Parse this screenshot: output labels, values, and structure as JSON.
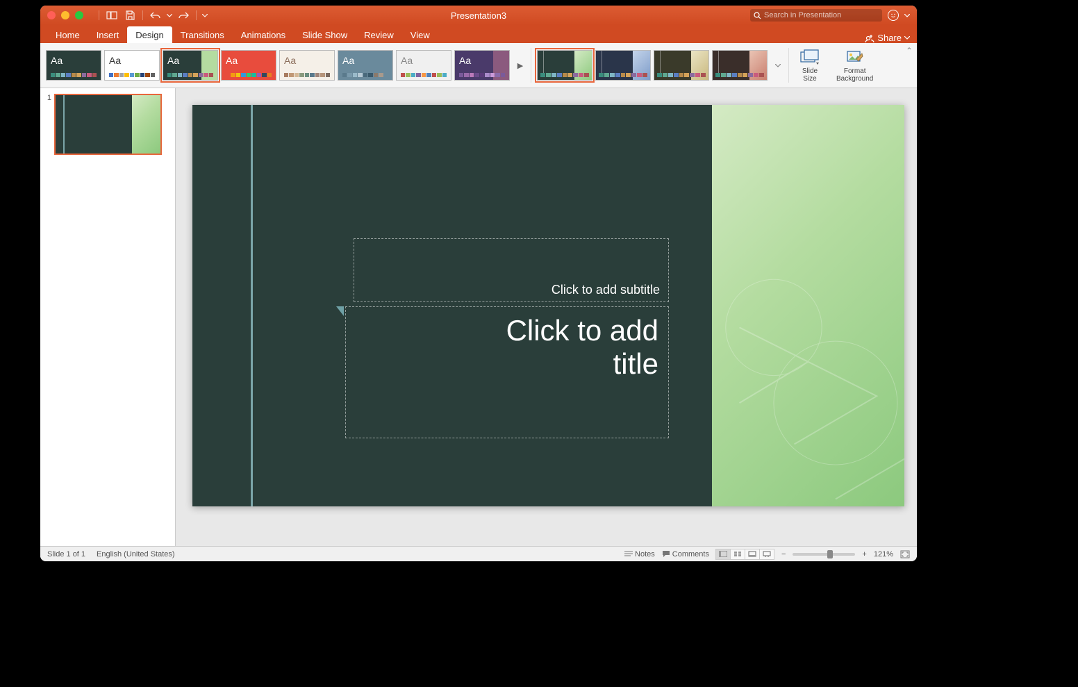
{
  "title": "Presentation3",
  "search_placeholder": "Search in Presentation",
  "share_label": "Share",
  "tabs": [
    "Home",
    "Insert",
    "Design",
    "Transitions",
    "Animations",
    "Slide Show",
    "Review",
    "View"
  ],
  "active_tab": "Design",
  "tools": {
    "slide_size": "Slide\nSize",
    "format_bg": "Format\nBackground"
  },
  "slide": {
    "subtitle_placeholder": "Click to add subtitle",
    "title_placeholder": "Click to add\ntitle"
  },
  "thumb_num": "1",
  "status": {
    "slide_info": "Slide 1 of 1",
    "language": "English (United States)",
    "notes": "Notes",
    "comments": "Comments",
    "zoom": "121%"
  },
  "theme_thumbs": [
    {
      "bg": "#2a3e3a",
      "aa": "#fff",
      "strip": [
        "#3a8d7d",
        "#5fa890",
        "#7eb5c4",
        "#5a7ec2",
        "#b88a4a",
        "#d4a259",
        "#8b6b9e",
        "#c95b7e",
        "#aa5252"
      ]
    },
    {
      "bg": "#ffffff",
      "aa": "#333",
      "strip": [
        "#4472c4",
        "#ed7d31",
        "#a5a5a5",
        "#ffc000",
        "#5b9bd5",
        "#70ad47",
        "#264478",
        "#9e480e",
        "#636363"
      ]
    },
    {
      "bg": "#2a3e3a",
      "aa": "#fff",
      "side": "#b4dca0",
      "sel": true,
      "strip": [
        "#3a8d7d",
        "#5fa890",
        "#7eb5c4",
        "#5a7ec2",
        "#b88a4a",
        "#d4a259",
        "#8b6b9e",
        "#c95b7e",
        "#aa5252"
      ]
    },
    {
      "bg": "#e84c3d",
      "aa": "#fff",
      "strip": [
        "#e84c3d",
        "#f39c12",
        "#f1c40f",
        "#3498db",
        "#2ecc71",
        "#1abc9c",
        "#9b59b6",
        "#34495e",
        "#e67e22"
      ]
    },
    {
      "bg": "#f5f0e8",
      "aa": "#8a6d5a",
      "strip": [
        "#a87c5f",
        "#c19875",
        "#d4b896",
        "#8a9a7e",
        "#6b8e7f",
        "#5a7a8c",
        "#9e8579",
        "#b6957a",
        "#7a6a5f"
      ]
    },
    {
      "bg": "#6a8a9c",
      "aa": "#fff",
      "strip": [
        "#5a7a8c",
        "#7a9aac",
        "#9abaca",
        "#b5c8d4",
        "#4a6a7c",
        "#3a5a6c",
        "#8a7a6c",
        "#a89a8c",
        "#6a8a9c"
      ]
    },
    {
      "bg": "#f0f0f0",
      "aa": "#888",
      "strip": [
        "#c0504d",
        "#9bbb59",
        "#4bacc6",
        "#8064a2",
        "#f79646",
        "#4f81bd",
        "#c0504d",
        "#9bbb59",
        "#4bacc6"
      ]
    },
    {
      "bg": "#4a3a6a",
      "aa": "#fff",
      "side": "#8b5a7e",
      "strip": [
        "#7a5a9a",
        "#9a6aaa",
        "#ba7aba",
        "#6a4a8a",
        "#5a3a7a",
        "#aa8aca",
        "#ca9ada",
        "#8a6aaa",
        "#7a5a9a"
      ]
    }
  ],
  "variants": [
    {
      "dark": "#2a3e3a",
      "light": "linear-gradient(135deg,#d4eac4,#8cc97e)",
      "sel": true
    },
    {
      "dark": "#2a354a",
      "light": "linear-gradient(135deg,#c4d4ea,#7e9cc9)"
    },
    {
      "dark": "#3a3a2a",
      "light": "linear-gradient(135deg,#eae4c4,#c9b87e)"
    },
    {
      "dark": "#3a2e2a",
      "light": "linear-gradient(135deg,#eac4b4,#c97e6e)"
    }
  ]
}
